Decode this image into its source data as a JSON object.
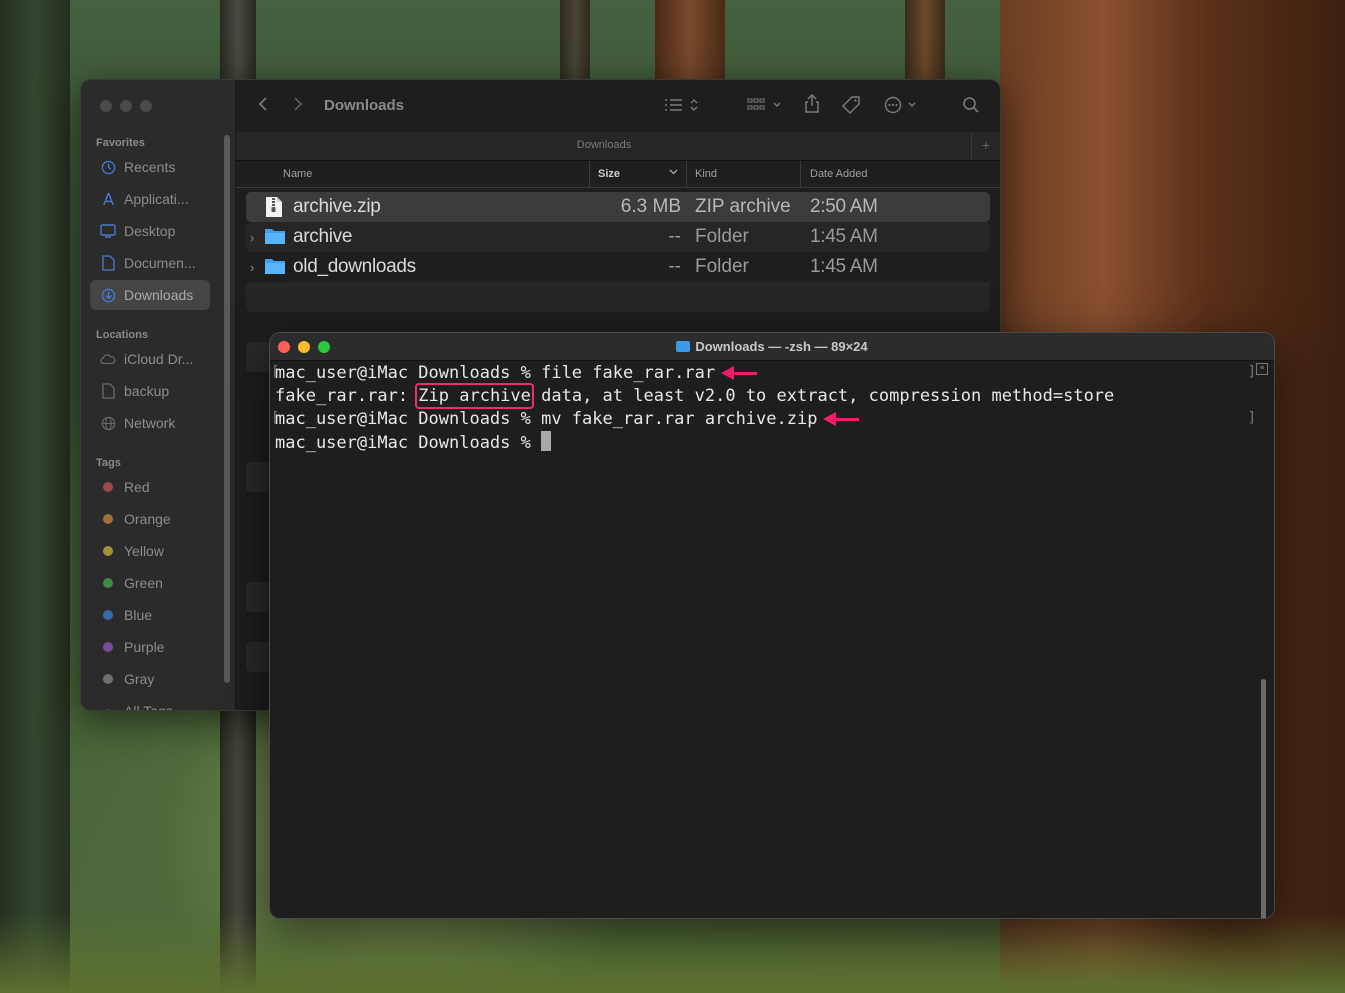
{
  "finder": {
    "title": "Downloads",
    "path_title": "Downloads",
    "sidebar": {
      "favorites_title": "Favorites",
      "favorites": [
        {
          "label": "Recents",
          "icon": "clock-icon"
        },
        {
          "label": "Applicati...",
          "icon": "applications-icon"
        },
        {
          "label": "Desktop",
          "icon": "desktop-icon"
        },
        {
          "label": "Documen...",
          "icon": "document-icon"
        },
        {
          "label": "Downloads",
          "icon": "downloads-icon",
          "active": true
        }
      ],
      "locations_title": "Locations",
      "locations": [
        {
          "label": "iCloud Dr...",
          "icon": "cloud-icon"
        },
        {
          "label": "backup",
          "icon": "document-icon"
        },
        {
          "label": "Network",
          "icon": "globe-icon"
        }
      ],
      "tags_title": "Tags",
      "tags": [
        {
          "label": "Red",
          "color": "#e0443e"
        },
        {
          "label": "Orange",
          "color": "#f0922c"
        },
        {
          "label": "Yellow",
          "color": "#f4c92b"
        },
        {
          "label": "Green",
          "color": "#3fc24a"
        },
        {
          "label": "Blue",
          "color": "#2f7de8"
        },
        {
          "label": "Purple",
          "color": "#a65ad2"
        },
        {
          "label": "Gray",
          "color": "#8e8e93"
        }
      ],
      "all_tags": "All Tags..."
    },
    "columns": {
      "name": "Name",
      "size": "Size",
      "kind": "Kind",
      "date": "Date Added"
    },
    "files": [
      {
        "name": "archive.zip",
        "size": "6.3 MB",
        "kind": "ZIP archive",
        "date": "2:50 AM",
        "type": "zip",
        "selected": true
      },
      {
        "name": "archive",
        "size": "--",
        "kind": "Folder",
        "date": "1:45 AM",
        "type": "folder"
      },
      {
        "name": "old_downloads",
        "size": "--",
        "kind": "Folder",
        "date": "1:45 AM",
        "type": "folder"
      }
    ]
  },
  "terminal": {
    "title": "Downloads — -zsh — 89×24",
    "lines": {
      "l1": "mac_user@iMac Downloads % file fake_rar.rar",
      "l2_prefix": "fake_rar.rar: ",
      "l2_highlight": "Zip archive",
      "l2_suffix": " data, at least v2.0 to extract, compression method=store",
      "l3": "mac_user@iMac Downloads % mv fake_rar.rar archive.zip",
      "l4": "mac_user@iMac Downloads % "
    },
    "annotation_color": "#ef2d6e"
  }
}
